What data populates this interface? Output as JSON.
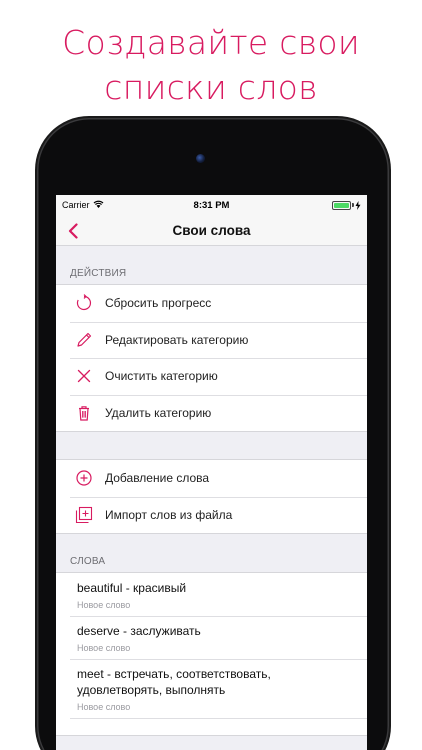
{
  "headline": {
    "line1": "Создавайте свои",
    "line2": "списки слов"
  },
  "colors": {
    "accent": "#d81b60",
    "background": "#efeff4",
    "battery": "#4cd964"
  },
  "status_bar": {
    "carrier": "Carrier",
    "time": "8:31 PM",
    "battery_level": 1.0
  },
  "nav": {
    "back_icon": "chevron-left-icon",
    "title": "Свои слова"
  },
  "actions": {
    "header": "ДЕЙСТВИЯ",
    "items": [
      {
        "label": "Сбросить прогресс",
        "icon": "refresh-icon"
      },
      {
        "label": "Редактировать категорию",
        "icon": "pencil-icon"
      },
      {
        "label": "Очистить категорию",
        "icon": "close-icon"
      },
      {
        "label": "Удалить категорию",
        "icon": "trash-icon"
      }
    ]
  },
  "add": {
    "items": [
      {
        "label": "Добавление слова",
        "icon": "add-circle-icon"
      },
      {
        "label": "Импорт слов из файла",
        "icon": "import-file-icon"
      }
    ]
  },
  "words": {
    "header": "СЛОВА",
    "items": [
      {
        "word": "beautiful - красивый",
        "status": "Новое слово"
      },
      {
        "word": "deserve - заслуживать",
        "status": "Новое слово"
      },
      {
        "word": "meet - встречать, соответствовать, удовлетворять, выполнять",
        "status": "Новое слово"
      },
      {
        "word": "",
        "status": ""
      }
    ]
  }
}
